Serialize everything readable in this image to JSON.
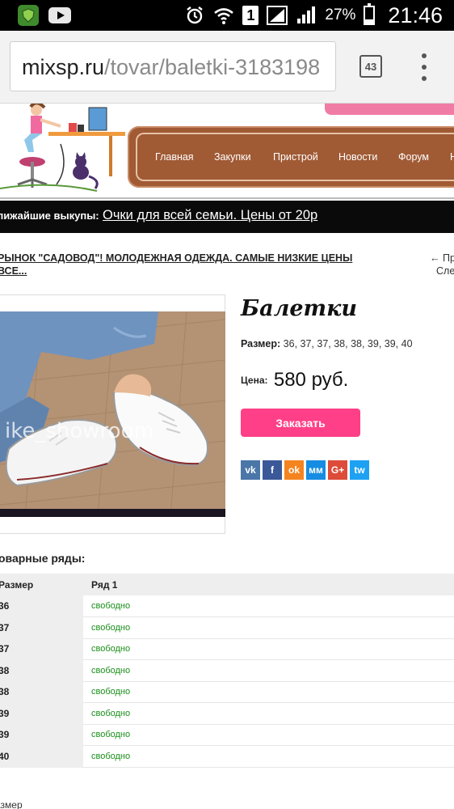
{
  "status_bar": {
    "battery_percent": "27%",
    "time": "21:46",
    "sim_label": "1",
    "icons": [
      "app-shield-icon",
      "youtube-icon",
      "alarm-icon",
      "wifi-icon",
      "signal-icon",
      "battery-icon"
    ]
  },
  "browser": {
    "url_host": "mixsp.ru",
    "url_path": "/tovar/baletki-3183198",
    "tab_count": "43"
  },
  "nav": {
    "items": [
      "Главная",
      "Закупки",
      "Пристрой",
      "Новости",
      "Форум",
      "Н"
    ]
  },
  "upcoming": {
    "label": "лижайшие выкупы:",
    "link": "Очки для всей семьи. Цены от 20р"
  },
  "breadcrumb": {
    "line1": "РЫНОК \"САДОВОД\"! МОЛОДЕЖНАЯ ОДЕЖДА. САМЫЕ НИЗКИЕ ЦЕНЫ",
    "line2": "ВСЕ..."
  },
  "prevnext": {
    "prev": "← Пр",
    "next": "Сле"
  },
  "product": {
    "image_watermark": "ike_showroom",
    "title": "Балетки",
    "sizes_label": "Размер:",
    "sizes_value": "36, 37, 37, 38, 38, 39, 39, 40",
    "price_label": "Цена:",
    "price_value": "580 руб.",
    "order_button": "Заказать"
  },
  "share": {
    "buttons": [
      {
        "label": "vk",
        "color": "#4a76a8"
      },
      {
        "label": "f",
        "color": "#3b5998"
      },
      {
        "label": "ok",
        "color": "#f48420"
      },
      {
        "label": "мм",
        "color": "#168de2"
      },
      {
        "label": "G+",
        "color": "#dd4b39"
      },
      {
        "label": "tw",
        "color": "#1da1f2"
      }
    ]
  },
  "rows": {
    "title": "оварные ряды:",
    "header_size": "Размер",
    "header_row": "Ряд 1",
    "items": [
      {
        "size": "36",
        "status": "свободно"
      },
      {
        "size": "37",
        "status": "свободно"
      },
      {
        "size": "37",
        "status": "свободно"
      },
      {
        "size": "38",
        "status": "свободно"
      },
      {
        "size": "38",
        "status": "свободно"
      },
      {
        "size": "39",
        "status": "свободно"
      },
      {
        "size": "39",
        "status": "свободно"
      },
      {
        "size": "40",
        "status": "свободно"
      }
    ]
  },
  "footer_text": "азмер",
  "colors": {
    "nav_brown": "#a05a34",
    "order_pink": "#ff3f87",
    "free_green": "#1a8f1a"
  }
}
